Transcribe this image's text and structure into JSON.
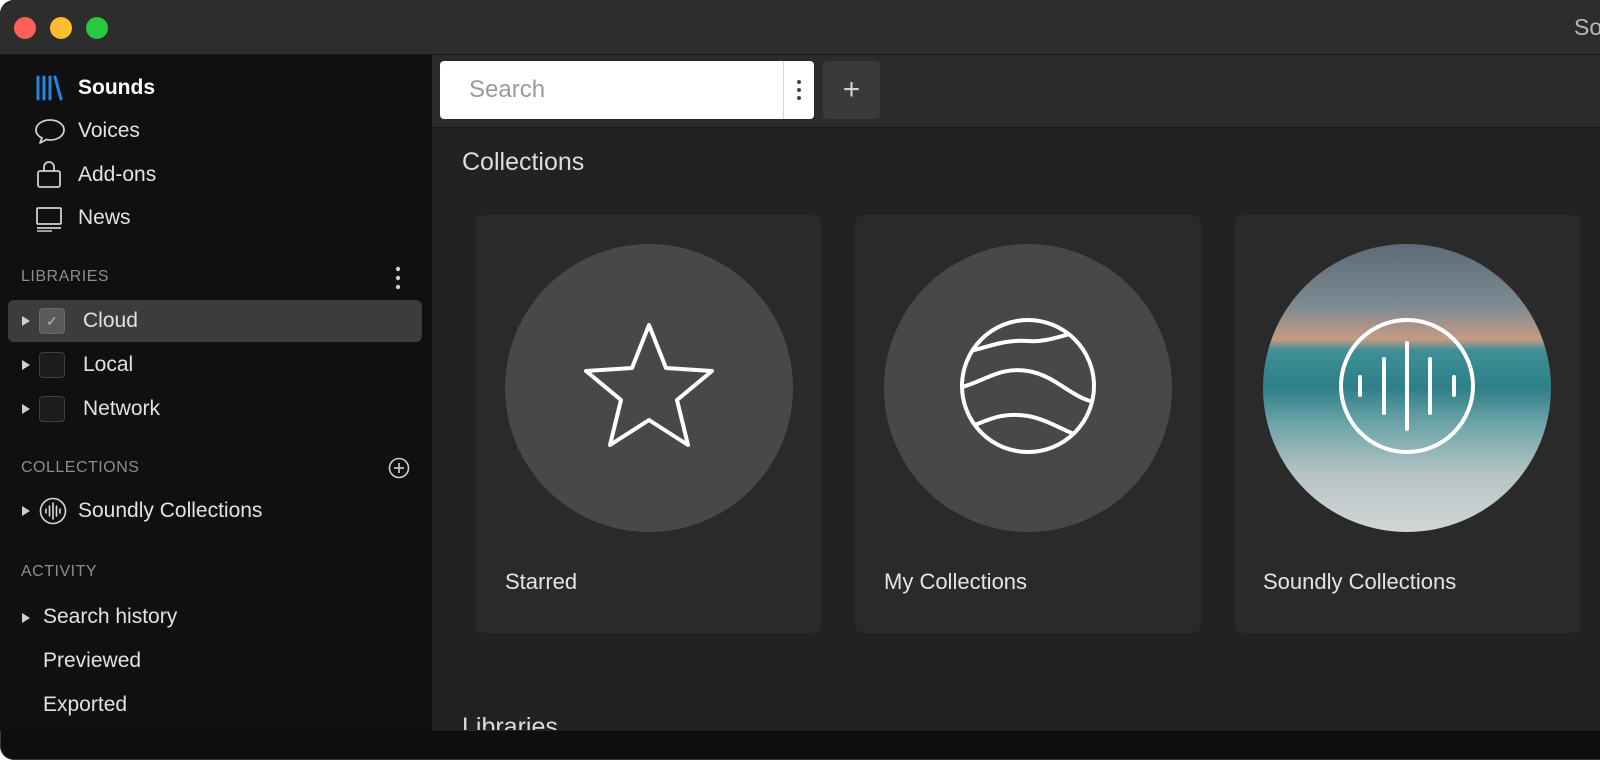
{
  "window": {
    "title": "Soundly",
    "lights": {
      "close": "#fe5f57",
      "minimize": "#febc2e",
      "zoom": "#28c840"
    }
  },
  "sidebar": {
    "accent": "#1e88e5",
    "nav": [
      {
        "label": "Sounds",
        "icon": "library-icon"
      },
      {
        "label": "Voices",
        "icon": "speech-bubble-icon"
      },
      {
        "label": "Add-ons",
        "icon": "shopping-bag-icon"
      },
      {
        "label": "News",
        "icon": "monitor-icon"
      }
    ],
    "libraries": {
      "heading": "LIBRARIES",
      "items": [
        {
          "label": "Cloud",
          "checked": true,
          "selected": true
        },
        {
          "label": "Local",
          "checked": false
        },
        {
          "label": "Network",
          "checked": false
        }
      ]
    },
    "collections": {
      "heading": "COLLECTIONS",
      "items": [
        {
          "label": "Soundly Collections",
          "icon": "soundly-icon"
        }
      ]
    },
    "activity": {
      "heading": "ACTIVITY",
      "items": [
        {
          "label": "Search history",
          "expandable": true
        },
        {
          "label": "Previewed"
        },
        {
          "label": "Exported"
        }
      ]
    }
  },
  "toolbar": {
    "search_placeholder": "Search",
    "add_label": "+"
  },
  "main": {
    "collections_title": "Collections",
    "cards": [
      {
        "label": "Starred",
        "icon": "star-icon"
      },
      {
        "label": "My Collections",
        "icon": "globe-waves-icon"
      },
      {
        "label": "Soundly Collections",
        "icon": "soundly-waveform-icon"
      }
    ],
    "next_section_title": "Libraries"
  }
}
